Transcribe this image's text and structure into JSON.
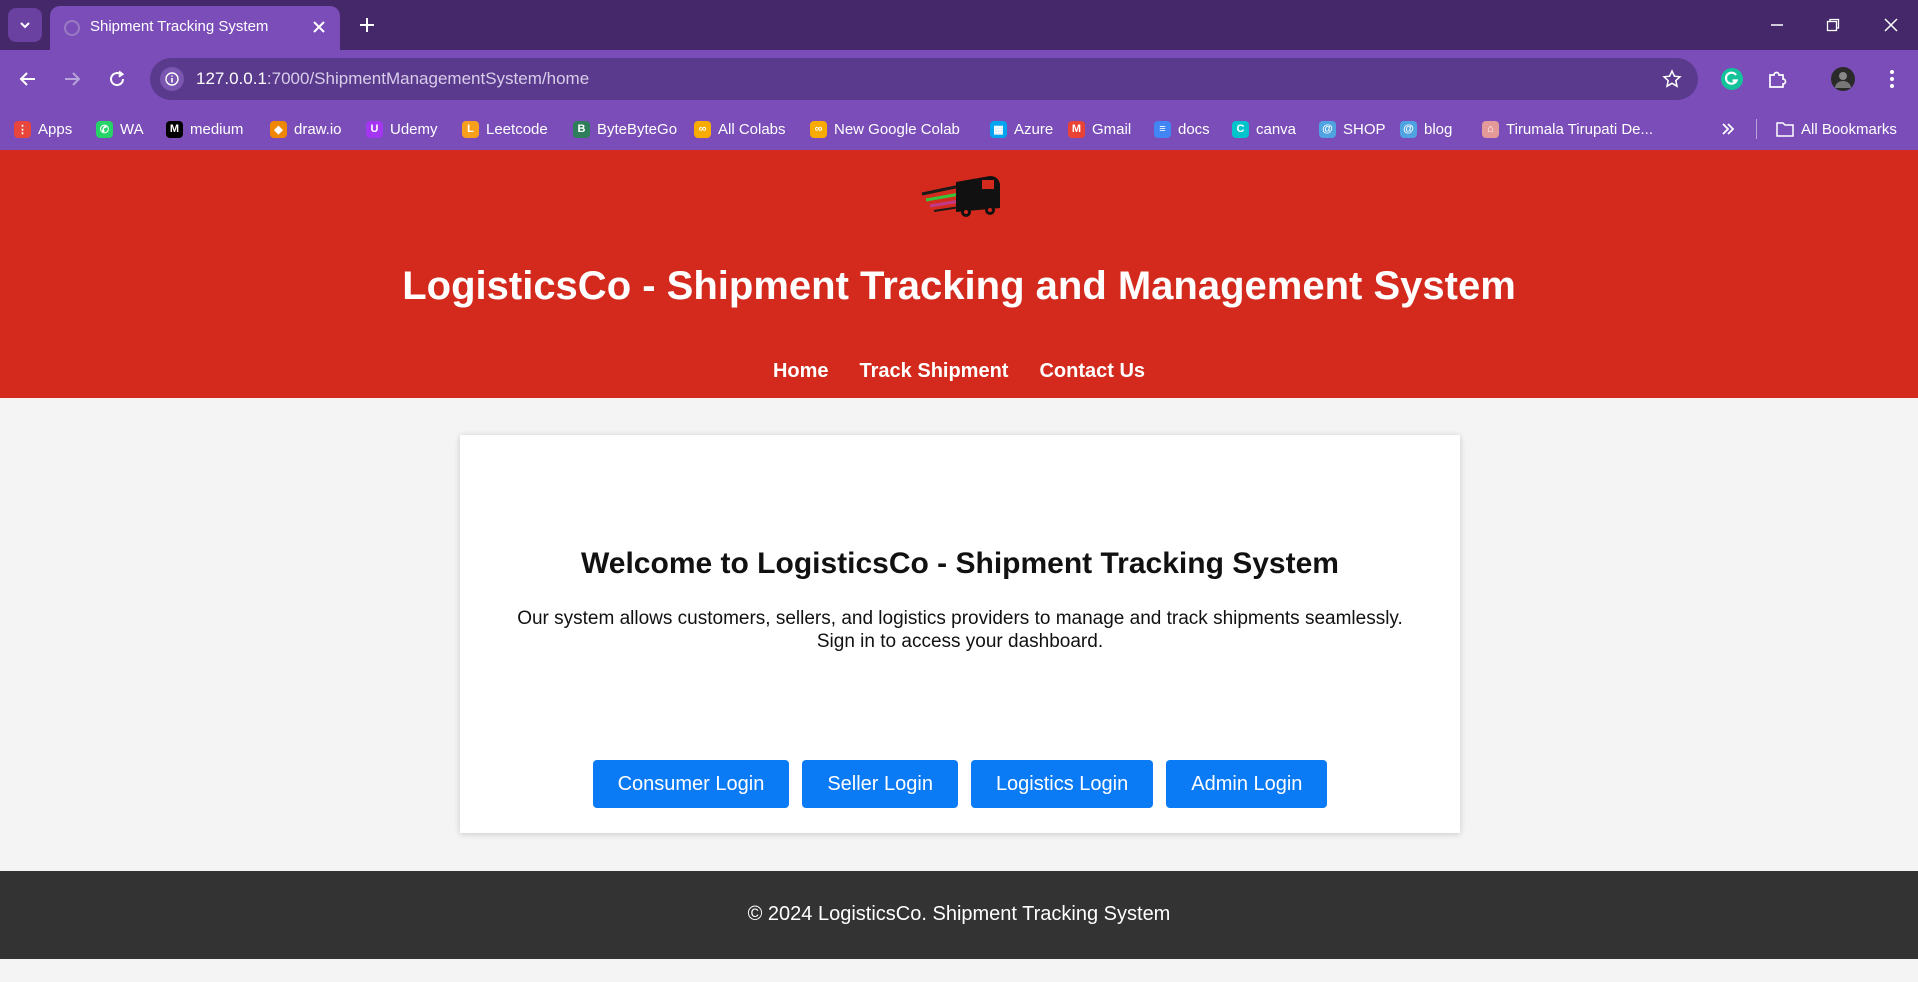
{
  "browser": {
    "tab_title": "Shipment Tracking System",
    "url_host": "127.0.0.1",
    "url_rest": ":7000/ShipmentManagementSystem/home",
    "bookmarks": [
      {
        "label": "Apps",
        "icon": "apps-grid-icon",
        "color": "#e8453c"
      },
      {
        "label": "WA",
        "icon": "whatsapp-icon",
        "color": "#25d366"
      },
      {
        "label": "medium",
        "icon": "medium-icon",
        "color": "#000000"
      },
      {
        "label": "draw.io",
        "icon": "drawio-icon",
        "color": "#f08705"
      },
      {
        "label": "Udemy",
        "icon": "udemy-icon",
        "color": "#a435f0"
      },
      {
        "label": "Leetcode",
        "icon": "leetcode-icon",
        "color": "#f89f1b"
      },
      {
        "label": "ByteByteGo",
        "icon": "bytebytego-icon",
        "color": "#2e7d5b"
      },
      {
        "label": "All Colabs",
        "icon": "colab-icon",
        "color": "#f9ab00"
      },
      {
        "label": "New Google Colab",
        "icon": "colab-icon",
        "color": "#f9ab00"
      },
      {
        "label": "Azure",
        "icon": "microsoft-icon",
        "color": "#00a4ef"
      },
      {
        "label": "Gmail",
        "icon": "gmail-icon",
        "color": "#ea4335"
      },
      {
        "label": "docs",
        "icon": "docs-icon",
        "color": "#4285f4"
      },
      {
        "label": "canva",
        "icon": "canva-icon",
        "color": "#00c4cc"
      },
      {
        "label": "SHOP",
        "icon": "spiral-icon",
        "color": "#4fa3e0"
      },
      {
        "label": "blog",
        "icon": "spiral-icon",
        "color": "#4fa3e0"
      },
      {
        "label": "Tirumala Tirupati De...",
        "icon": "temple-icon",
        "color": "#e59a9a"
      }
    ],
    "all_bookmarks": "All Bookmarks"
  },
  "header": {
    "title": "LogisticsCo - Shipment Tracking and Management System",
    "nav": [
      "Home",
      "Track Shipment",
      "Contact Us"
    ]
  },
  "main": {
    "heading": "Welcome to LogisticsCo - Shipment Tracking System",
    "line1": "Our system allows customers, sellers, and logistics providers to manage and track shipments seamlessly.",
    "line2": "Sign in to access your dashboard.",
    "buttons": [
      "Consumer Login",
      "Seller Login",
      "Logistics Login",
      "Admin Login"
    ]
  },
  "footer": {
    "text": "© 2024 LogisticsCo. Shipment Tracking System"
  },
  "colors": {
    "header_red": "#d42a1e",
    "button_blue": "#0a7bf5",
    "footer_dark": "#333333",
    "chrome_purple": "#7b4db8"
  }
}
